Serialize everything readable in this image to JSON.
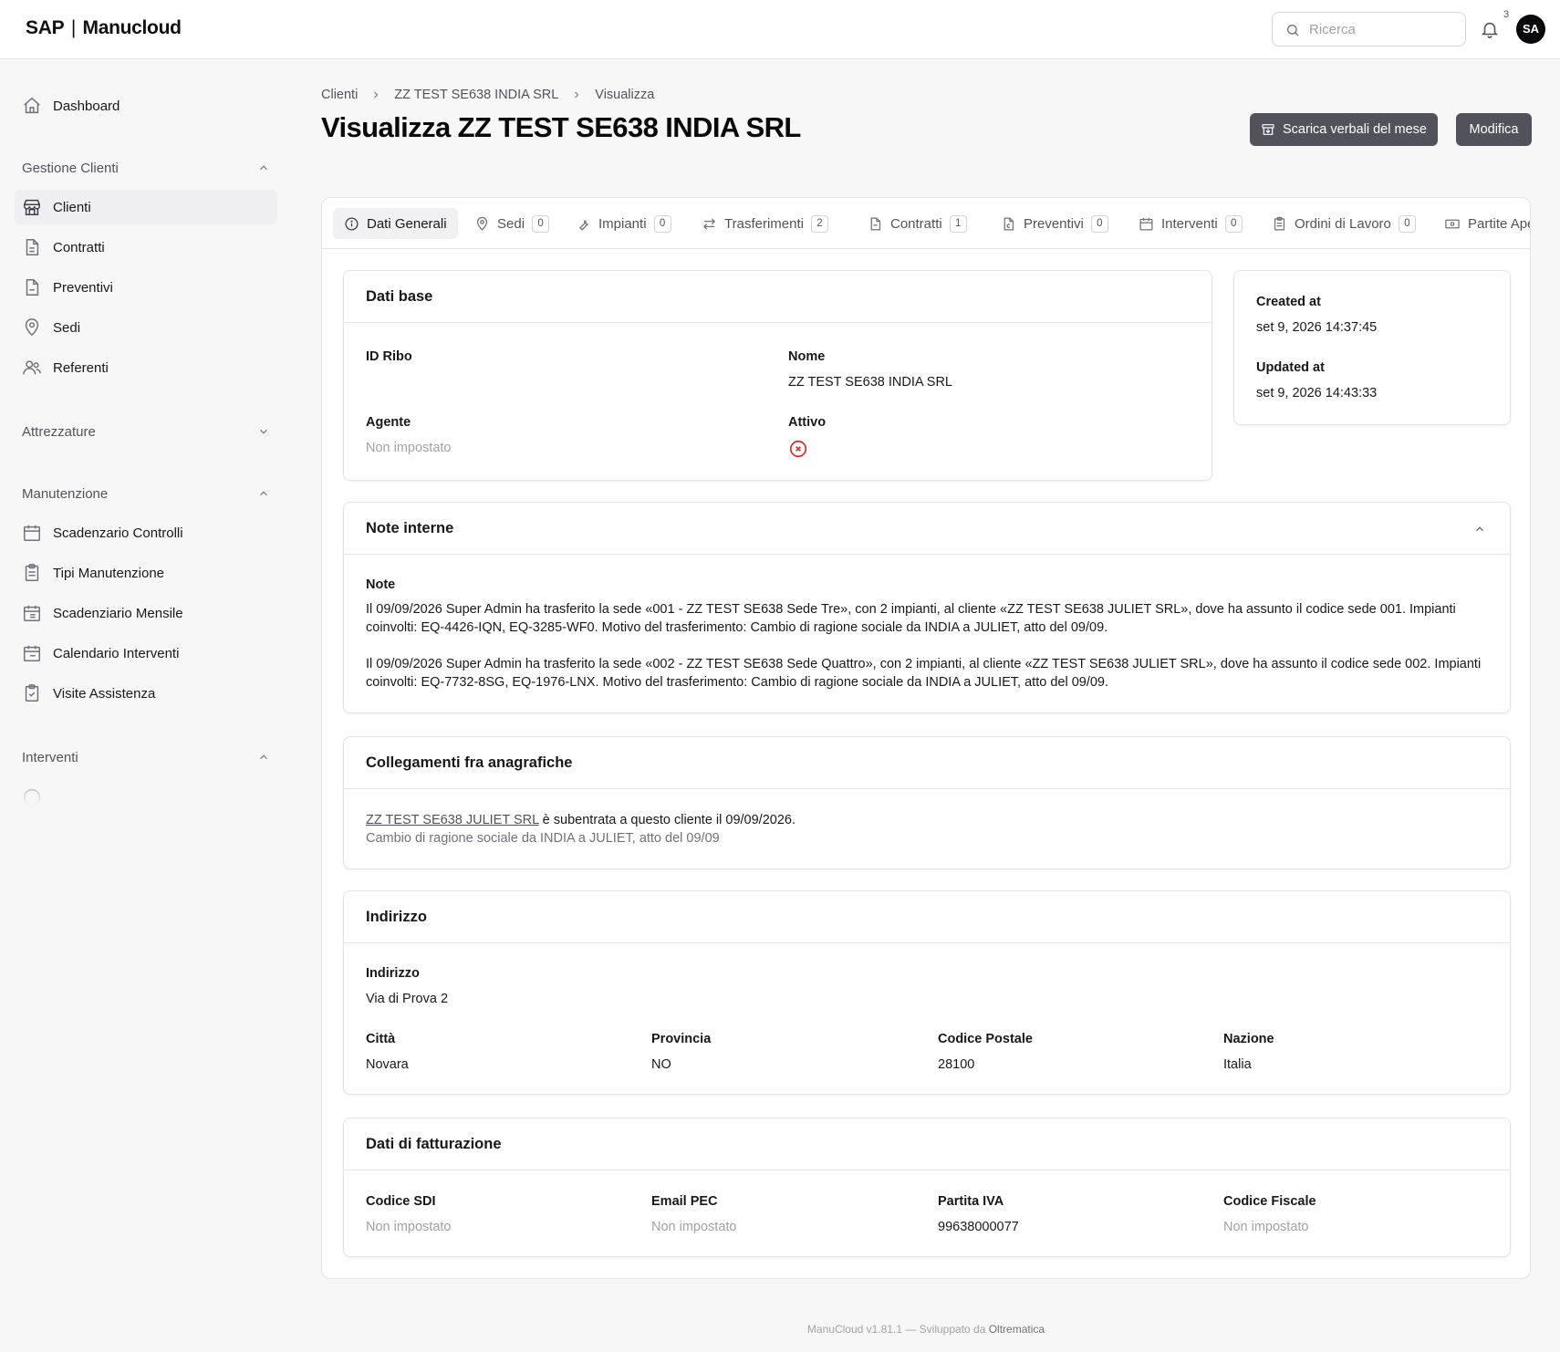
{
  "app": {
    "logo_brand": "SAP",
    "logo_name": "Manucloud",
    "search_placeholder": "Ricerca",
    "notifications_count": "3",
    "avatar_initials": "SA"
  },
  "sidebar": {
    "dashboard": "Dashboard",
    "sections": {
      "gestione_clienti": "Gestione Clienti",
      "attrezzature": "Attrezzature",
      "manutenzione": "Manutenzione",
      "interventi": "Interventi"
    },
    "clienti_items": [
      "Clienti",
      "Contratti",
      "Preventivi",
      "Sedi",
      "Referenti"
    ],
    "manutenzione_items": [
      "Scadenzario Controlli",
      "Tipi Manutenzione",
      "Scadenziario Mensile",
      "Calendario Interventi",
      "Visite Assistenza"
    ]
  },
  "breadcrumb": [
    "Clienti",
    "ZZ TEST SE638 INDIA SRL",
    "Visualizza"
  ],
  "page": {
    "title": "Visualizza ZZ TEST SE638 INDIA SRL",
    "download_button": "Scarica verbali del mese",
    "edit_button": "Modifica"
  },
  "tabs": [
    {
      "label": "Dati Generali",
      "count": null
    },
    {
      "label": "Sedi",
      "count": "0"
    },
    {
      "label": "Impianti",
      "count": "0"
    },
    {
      "label": "Trasferimenti",
      "count": "2"
    },
    {
      "label": "Contratti",
      "count": "1"
    },
    {
      "label": "Preventivi",
      "count": "0"
    },
    {
      "label": "Interventi",
      "count": "0"
    },
    {
      "label": "Ordini di Lavoro",
      "count": "0"
    },
    {
      "label": "Partite Aper",
      "count": null
    }
  ],
  "dati_base": {
    "title": "Dati base",
    "id_ribo_label": "ID Ribo",
    "nome_label": "Nome",
    "nome_value": "ZZ TEST SE638 INDIA SRL",
    "agente_label": "Agente",
    "agente_value": "Non impostato",
    "attivo_label": "Attivo"
  },
  "meta": {
    "created_label": "Created at",
    "created_value": "set 9, 2026 14:37:45",
    "updated_label": "Updated at",
    "updated_value": "set 9, 2026 14:43:33"
  },
  "note_interne": {
    "title": "Note interne",
    "note_label": "Note",
    "paragraphs": [
      "Il 09/09/2026 Super Admin ha trasferito la sede «001 - ZZ TEST SE638 Sede Tre», con 2 impianti, al cliente «ZZ TEST SE638 JULIET SRL», dove ha assunto il codice sede 001. Impianti coinvolti: EQ-4426-IQN, EQ-3285-WF0. Motivo del trasferimento: Cambio di ragione sociale da INDIA a JULIET, atto del 09/09.",
      "Il 09/09/2026 Super Admin ha trasferito la sede «002 - ZZ TEST SE638 Sede Quattro», con 2 impianti, al cliente «ZZ TEST SE638 JULIET SRL», dove ha assunto il codice sede 002. Impianti coinvolti: EQ-7732-8SG, EQ-1976-LNX. Motivo del trasferimento: Cambio di ragione sociale da INDIA a JULIET, atto del 09/09."
    ]
  },
  "collegamenti": {
    "title": "Collegamenti fra anagrafiche",
    "link_text": "ZZ TEST SE638 JULIET SRL",
    "sentence_rest": " è subentrata a questo cliente il 09/09/2026.",
    "reason": "Cambio di ragione sociale da INDIA a JULIET, atto del 09/09"
  },
  "indirizzo": {
    "title": "Indirizzo",
    "indirizzo_label": "Indirizzo",
    "indirizzo_value": "Via di Prova 2",
    "citta_label": "Città",
    "citta_value": "Novara",
    "provincia_label": "Provincia",
    "provincia_value": "NO",
    "cap_label": "Codice Postale",
    "cap_value": "28100",
    "nazione_label": "Nazione",
    "nazione_value": "Italia"
  },
  "fatturazione": {
    "title": "Dati di fatturazione",
    "sdi_label": "Codice SDI",
    "sdi_value": "Non impostato",
    "pec_label": "Email PEC",
    "pec_value": "Non impostato",
    "piva_label": "Partita IVA",
    "piva_value": "99638000077",
    "cf_label": "Codice Fiscale",
    "cf_value": "Non impostato"
  },
  "footer": {
    "text": "ManuCloud v1.81.1 — Sviluppato da ",
    "company": "Oltrematica"
  }
}
